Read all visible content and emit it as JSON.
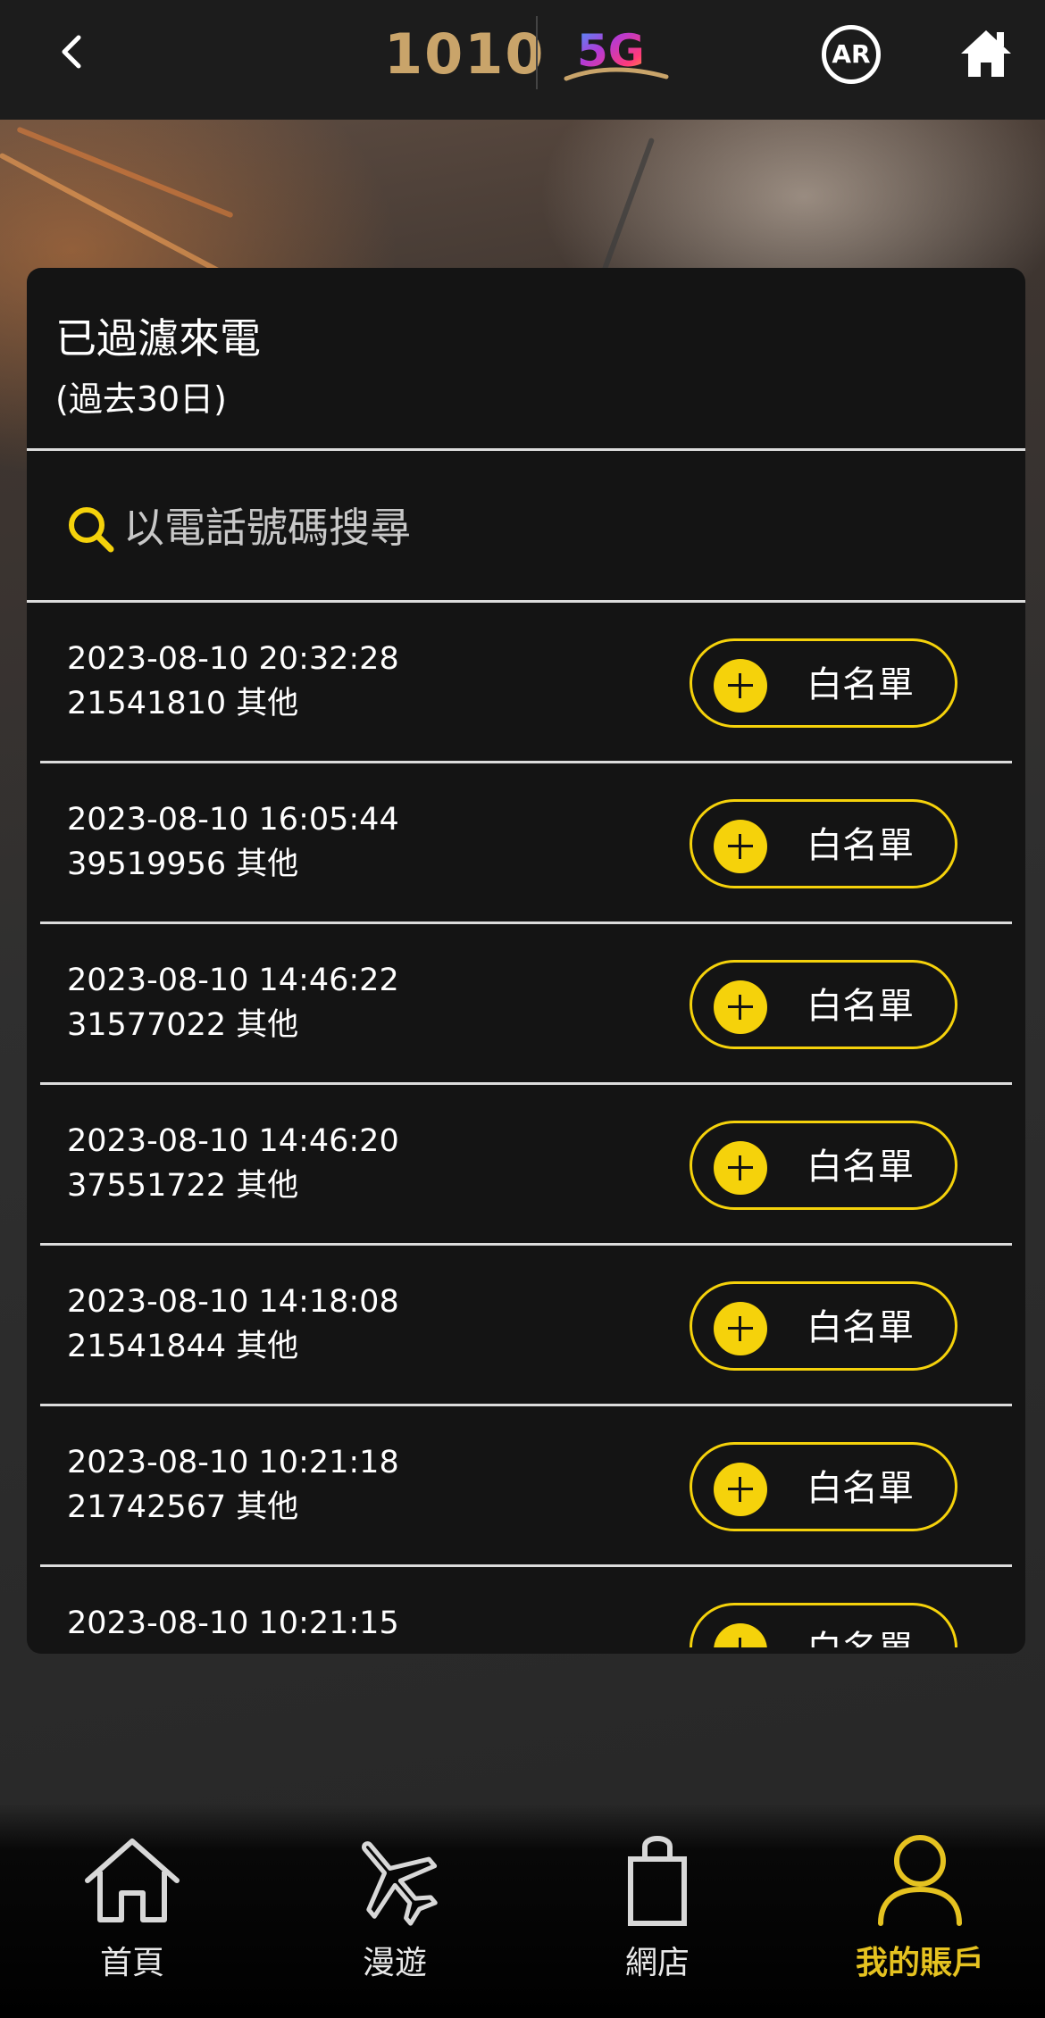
{
  "header": {
    "logo_text": "1010",
    "logo_5g": "5G",
    "ar_label": "AR"
  },
  "card": {
    "title": "已過濾來電",
    "subtitle": "(過去30日)"
  },
  "search": {
    "placeholder": "以電話號碼搜尋"
  },
  "calls": [
    {
      "time": "2023-08-10 20:32:28",
      "number": "21541810 其他",
      "button": "白名單"
    },
    {
      "time": "2023-08-10 16:05:44",
      "number": "39519956 其他",
      "button": "白名單"
    },
    {
      "time": "2023-08-10 14:46:22",
      "number": "31577022 其他",
      "button": "白名單"
    },
    {
      "time": "2023-08-10 14:46:20",
      "number": "37551722 其他",
      "button": "白名單"
    },
    {
      "time": "2023-08-10 14:18:08",
      "number": "21541844 其他",
      "button": "白名單"
    },
    {
      "time": "2023-08-10 10:21:18",
      "number": "21742567 其他",
      "button": "白名單"
    },
    {
      "time": "2023-08-10 10:21:15",
      "number": "",
      "button": "白名單"
    }
  ],
  "nav": {
    "items": [
      {
        "label": "首頁",
        "icon": "home-icon"
      },
      {
        "label": "漫遊",
        "icon": "airplane-icon"
      },
      {
        "label": "網店",
        "icon": "shopping-bag-icon"
      },
      {
        "label": "我的賬戶",
        "icon": "user-icon",
        "active": true
      }
    ]
  },
  "colors": {
    "accent": "#f5d20b",
    "active_nav": "#e5c220",
    "card_bg": "#141414",
    "logo_gold": "#c9a46a"
  }
}
